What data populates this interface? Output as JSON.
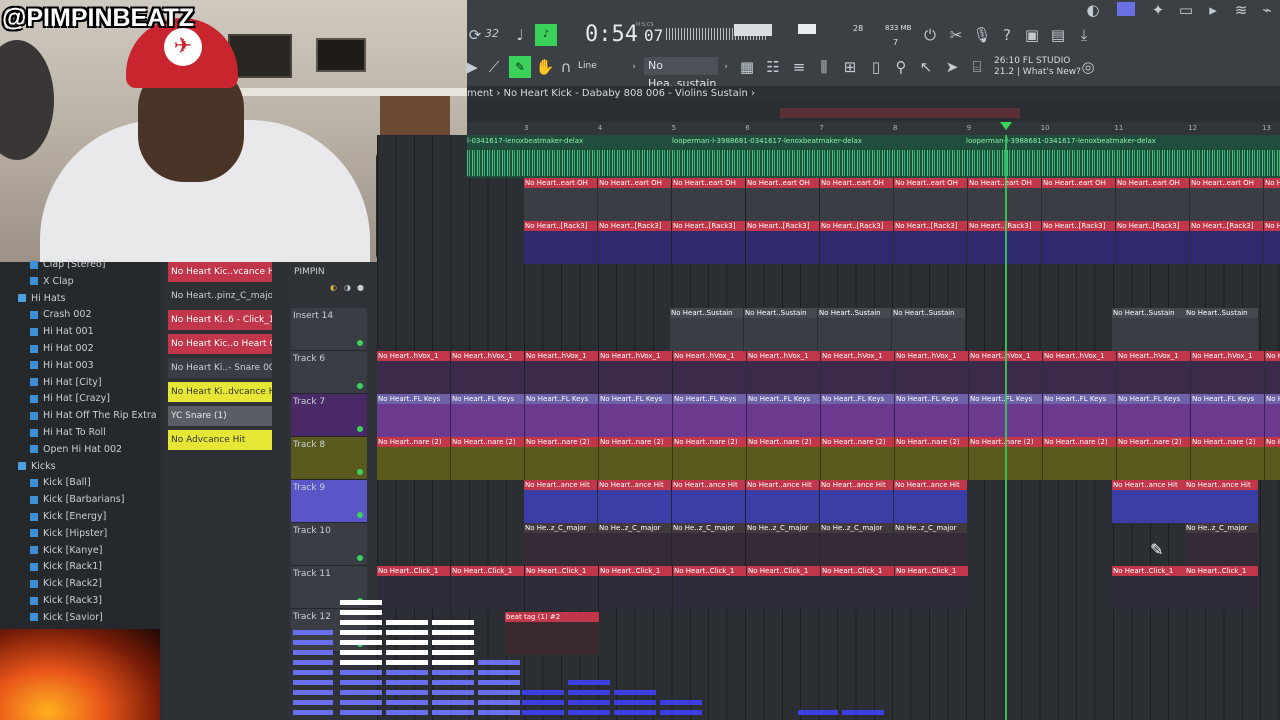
{
  "overlay": {
    "streamer_handle": "@PIMPINBEATZ"
  },
  "toolbar": {
    "time": "0:54",
    "time_small": "07",
    "time_unit": "M:S:CS",
    "tempo_label": "32",
    "cpu": "28",
    "memory": "833 MB",
    "voices": "7",
    "snap": "Line",
    "pattern_name": "No Hea..sustain",
    "hint_line1": "26:10  FL STUDIO",
    "hint_line2": "21.2 | What's New?"
  },
  "playlist": {
    "breadcrumb": "ment  ›  No Heart Kick - Dababy 808 006 - Violins Sustain  ›",
    "ruler": [
      "3",
      "4",
      "5",
      "6",
      "7",
      "8",
      "9",
      "10",
      "11",
      "12",
      "13"
    ],
    "audio_clip_label": "looperman-l-3988681-0341617-lenoxbeatmaker-delax",
    "audio_clip_label_left": "l-0341617-lenoxbeatmaker-delax",
    "mixer_name": "PIMPIN",
    "lane_labels": {
      "r1": "No Heart..eart OH",
      "r2": "No Heart..[Rack3]",
      "sustain": "No Heart..Sustain",
      "vox": "No Heart..hVox_1",
      "keys": "No Heart..FL Keys",
      "snare": "No Heart..nare (2)",
      "ance": "No Heart..ance Hit",
      "major": "No He..z_C_major",
      "click": "No Heart..Click_1",
      "beat_tag": "beat tag (1) #2"
    },
    "tracks": [
      {
        "name": "Insert 14"
      },
      {
        "name": "Track 6"
      },
      {
        "name": "Track 7"
      },
      {
        "name": "Track 8"
      },
      {
        "name": "Track 9"
      },
      {
        "name": "Track 10"
      },
      {
        "name": "Track 11"
      },
      {
        "name": "Track 12"
      }
    ]
  },
  "picker": {
    "items": [
      {
        "label": "No Heart Kic..vcance Hit"
      },
      {
        "label": "No Heart..pinz_C_major"
      },
      {
        "label": "No Heart Ki..6 - Click_1"
      },
      {
        "label": "No Heart Kic..o Heart OH"
      },
      {
        "label": "No Heart Ki..- Snare 006"
      },
      {
        "label": "No Heart Ki..dvcance Hit"
      },
      {
        "label": "YC Snare (1)"
      },
      {
        "label": "No Advcance Hit"
      }
    ]
  },
  "browser": {
    "items": [
      {
        "label": "Clap [Stereo]",
        "type": "file"
      },
      {
        "label": "X Clap",
        "type": "file"
      },
      {
        "label": "Hi Hats",
        "type": "folder"
      },
      {
        "label": "Crash 002",
        "type": "file"
      },
      {
        "label": "Hi Hat 001",
        "type": "file"
      },
      {
        "label": "Hi Hat 002",
        "type": "file"
      },
      {
        "label": "Hi Hat 003",
        "type": "file"
      },
      {
        "label": "Hi Hat [City]",
        "type": "file"
      },
      {
        "label": "Hi Hat [Crazy]",
        "type": "file"
      },
      {
        "label": "Hi Hat Off The Rip Extra",
        "type": "file"
      },
      {
        "label": "Hi Hat To Roll",
        "type": "file"
      },
      {
        "label": "Open Hi Hat 002",
        "type": "file"
      },
      {
        "label": "Kicks",
        "type": "folder"
      },
      {
        "label": "Kick [Ball]",
        "type": "file"
      },
      {
        "label": "Kick [Barbarians]",
        "type": "file"
      },
      {
        "label": "Kick [Energy]",
        "type": "file"
      },
      {
        "label": "Kick [Hipster]",
        "type": "file"
      },
      {
        "label": "Kick [Kanye]",
        "type": "file"
      },
      {
        "label": "Kick [Rack1]",
        "type": "file"
      },
      {
        "label": "Kick [Rack2]",
        "type": "file"
      },
      {
        "label": "Kick [Rack3]",
        "type": "file"
      },
      {
        "label": "Kick [Savior]",
        "type": "file"
      }
    ]
  },
  "colors": {
    "accent_green": "#3ad25a",
    "red_clip": "#c2364a",
    "purple_clip": "#6b3a8e",
    "olive_clip": "#5a5a1e",
    "blue_clip": "#3b3ea6",
    "navy_clip": "#2f2a6e",
    "selected_track": "#5a56c8"
  }
}
